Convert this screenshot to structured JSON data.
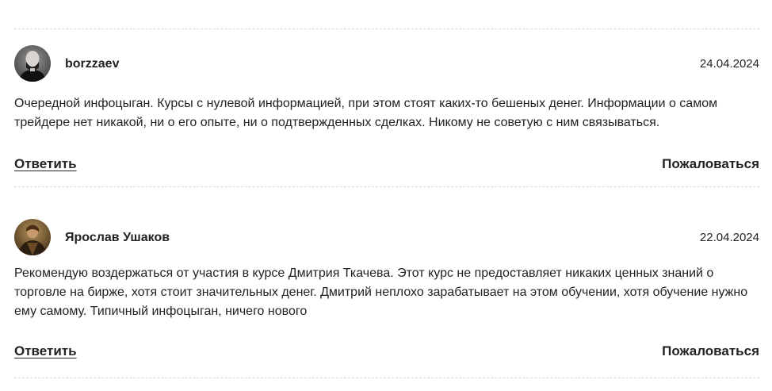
{
  "comments": [
    {
      "author": "borzzaev",
      "date": "24.04.2024",
      "text": "Очередной инфоцыган. Курсы с нулевой информацией, при этом стоят каких-то бешеных денег. Информации о самом трейдере нет никакой, ни о его опыте, ни о подтвержденных сделках. Никому не советую с ним связываться.",
      "reply_label": "Ответить",
      "report_label": "Пожаловаться",
      "avatar_icon": "user-photo-avatar"
    },
    {
      "author": "Ярослав Ушаков",
      "date": "22.04.2024",
      "text": "Рекомендую воздержаться от участия в курсе Дмитрия Ткачева. Этот курс не предоставляет никаких ценных знаний о торговле на бирже, хотя стоит значительных денег. Дмитрий неплохо зарабатывает на этом обучении, хотя обучение нужно ему самому. Типичный инфоцыган, ничего нового",
      "reply_label": "Ответить",
      "report_label": "Пожаловаться",
      "avatar_icon": "user-photo-avatar"
    }
  ],
  "colors": {
    "text": "#222222",
    "divider": "#d7d7d7"
  }
}
